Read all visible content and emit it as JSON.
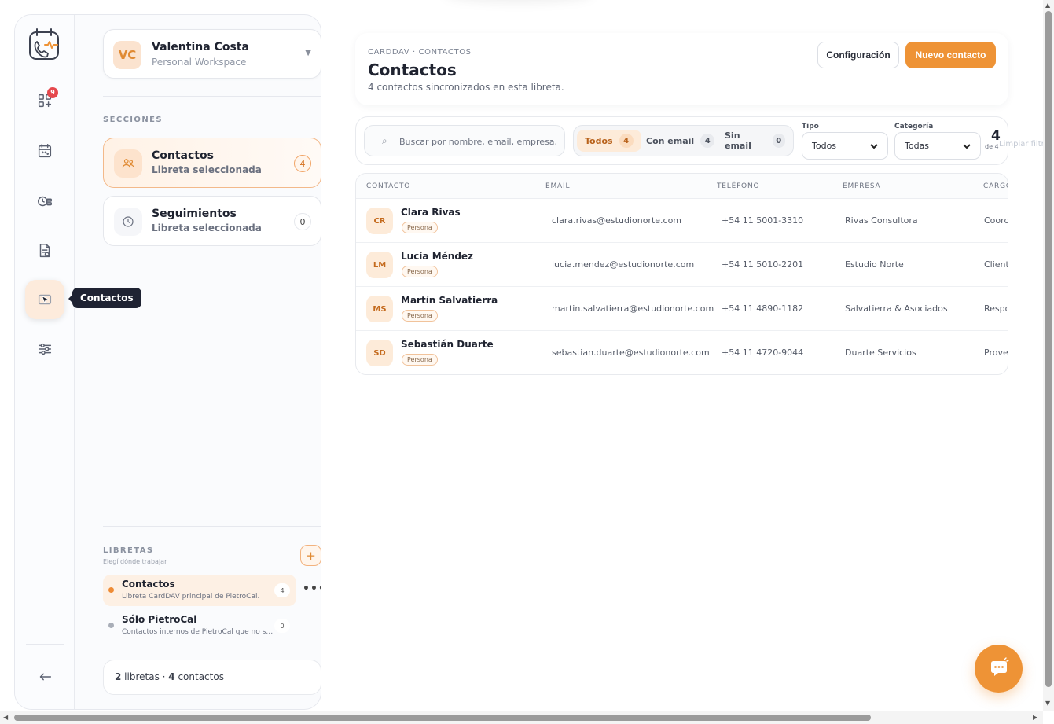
{
  "workspace": {
    "initials": "VC",
    "name": "Valentina Costa",
    "subtitle": "Personal Workspace"
  },
  "rail": {
    "apps_badge": "9",
    "tooltip": "Contactos"
  },
  "sections": {
    "label": "SECCIONES",
    "items": [
      {
        "title": "Contactos",
        "subtitle": "Libreta seleccionada",
        "count": "4"
      },
      {
        "title": "Seguimientos",
        "subtitle": "Libreta seleccionada",
        "count": "0"
      }
    ]
  },
  "libraries": {
    "label": "LIBRETAS",
    "hint": "Elegí dónde trabajar",
    "add_label": "+",
    "more_label": "•••",
    "items": [
      {
        "name": "Contactos",
        "description": "Libreta CardDAV principal de PietroCal.",
        "count": "4"
      },
      {
        "name": "Sólo PietroCal",
        "description": "Contactos internos de PietroCal que no se sincronizan.",
        "count": "0"
      }
    ]
  },
  "summary": {
    "libretas_count": "2",
    "libretas_text": " libretas · ",
    "contacts_count": "4",
    "contacts_text": " contactos"
  },
  "header": {
    "breadcrumb": "CARDDAV · CONTACTOS",
    "title": "Contactos",
    "subtitle": "4 contactos sincronizados en esta libreta.",
    "config_button": "Configuración",
    "new_button": "Nuevo contacto"
  },
  "filters": {
    "search_placeholder": "Buscar por nombre, email, empresa,",
    "segments": [
      {
        "label": "Todos",
        "count": "4"
      },
      {
        "label": "Con email",
        "count": "4"
      },
      {
        "label": "Sin email",
        "count": "0"
      }
    ],
    "tipo_label": "Tipo",
    "tipo_value": "Todos",
    "categoria_label": "Categoría",
    "categoria_value": "Todas",
    "result_count": "4",
    "result_of": "de 4",
    "clear_label": "Limpiar filtros"
  },
  "table": {
    "columns": [
      "CONTACTO",
      "EMAIL",
      "TELÉFONO",
      "EMPRESA",
      "CARGO"
    ],
    "rows": [
      {
        "initials": "CR",
        "name": "Clara Rivas",
        "tag": "Persona",
        "email": "clara.rivas@estudionorte.com",
        "phone": "+54 11 5001-3310",
        "company": "Rivas Consultora",
        "role": "Coordinadora"
      },
      {
        "initials": "LM",
        "name": "Lucía Méndez",
        "tag": "Persona",
        "email": "lucia.mendez@estudionorte.com",
        "phone": "+54 11 5010-2201",
        "company": "Estudio Norte",
        "role": "Cliente"
      },
      {
        "initials": "MS",
        "name": "Martín Salvatierra",
        "tag": "Persona",
        "email": "martin.salvatierra@estudionorte.com",
        "phone": "+54 11 4890-1182",
        "company": "Salvatierra & Asociados",
        "role": "Responsable"
      },
      {
        "initials": "SD",
        "name": "Sebastián Duarte",
        "tag": "Persona",
        "email": "sebastian.duarte@estudionorte.com",
        "phone": "+54 11 4720-9044",
        "company": "Duarte Servicios",
        "role": "Proveedor"
      }
    ]
  },
  "colors": {
    "accent": "#ee9336",
    "badge": "#e5484d",
    "tooltip_bg": "#1f2333"
  }
}
